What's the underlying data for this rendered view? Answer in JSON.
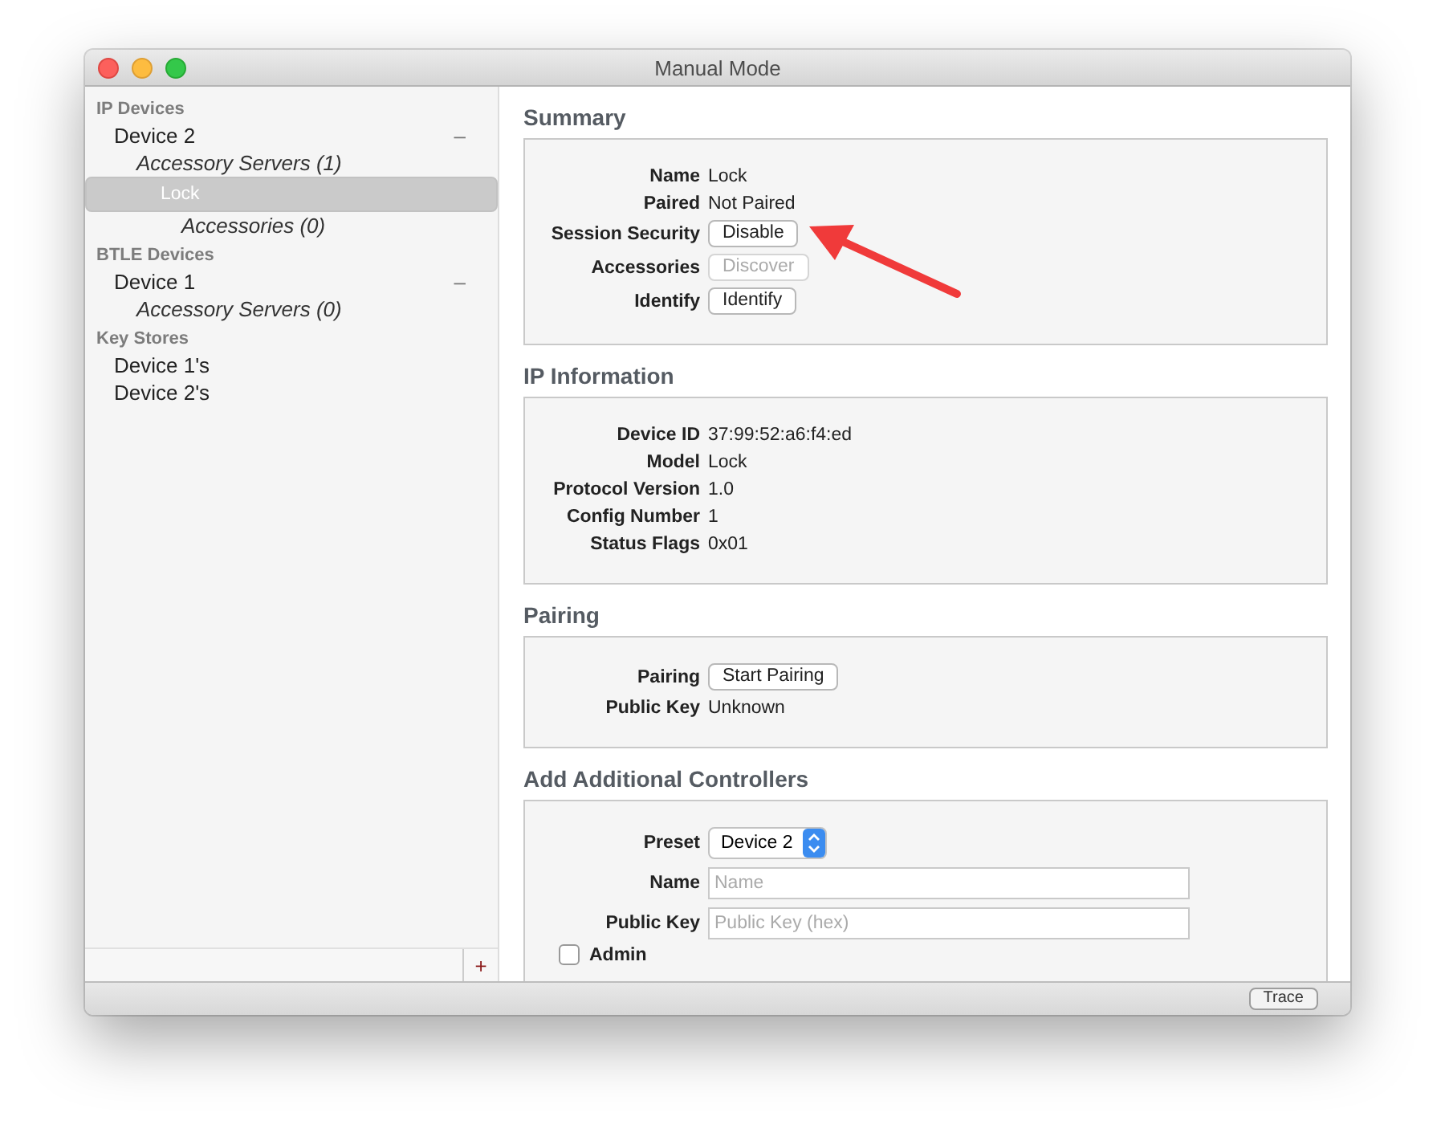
{
  "window": {
    "title": "Manual Mode"
  },
  "sidebar": {
    "groups": [
      {
        "heading": "IP Devices",
        "items": [
          {
            "label": "Device 2",
            "toggle": "–",
            "italic": false,
            "selected": false,
            "children": [
              {
                "label": "Accessory Servers (1)",
                "italic": true,
                "selected": false,
                "children": [
                  {
                    "label": "Lock",
                    "italic": false,
                    "selected": true,
                    "children": [
                      {
                        "label": "Accessories (0)",
                        "italic": true,
                        "selected": false
                      }
                    ]
                  }
                ]
              }
            ]
          }
        ]
      },
      {
        "heading": "BTLE Devices",
        "items": [
          {
            "label": "Device 1",
            "toggle": "–",
            "italic": false,
            "selected": false,
            "children": [
              {
                "label": "Accessory Servers (0)",
                "italic": true,
                "selected": false
              }
            ]
          }
        ]
      },
      {
        "heading": "Key Stores",
        "items": [
          {
            "label": "Device 1's",
            "italic": false,
            "selected": false
          },
          {
            "label": "Device 2's",
            "italic": false,
            "selected": false
          }
        ]
      }
    ],
    "add_button": "+"
  },
  "sections": [
    {
      "title": "Summary",
      "rows": [
        {
          "kind": "text",
          "label": "Name",
          "value": "Lock"
        },
        {
          "kind": "text",
          "label": "Paired",
          "value": "Not Paired"
        },
        {
          "kind": "button",
          "label": "Session Security",
          "value": "Disable",
          "disabled": false
        },
        {
          "kind": "button",
          "label": "Accessories",
          "value": "Discover",
          "disabled": true
        },
        {
          "kind": "button",
          "label": "Identify",
          "value": "Identify",
          "disabled": false
        }
      ]
    },
    {
      "title": "IP Information",
      "rows": [
        {
          "kind": "text",
          "label": "Device ID",
          "value": "37:99:52:a6:f4:ed"
        },
        {
          "kind": "text",
          "label": "Model",
          "value": "Lock"
        },
        {
          "kind": "text",
          "label": "Protocol Version",
          "value": "1.0"
        },
        {
          "kind": "text",
          "label": "Config Number",
          "value": "1"
        },
        {
          "kind": "text",
          "label": "Status Flags",
          "value": "0x01"
        }
      ]
    },
    {
      "title": "Pairing",
      "rows": [
        {
          "kind": "button",
          "label": "Pairing",
          "value": "Start Pairing",
          "disabled": false
        },
        {
          "kind": "text",
          "label": "Public Key",
          "value": "Unknown"
        }
      ]
    },
    {
      "title": "Add Additional Controllers",
      "rows": [
        {
          "kind": "select",
          "label": "Preset",
          "value": "Device 2"
        },
        {
          "kind": "input",
          "label": "Name",
          "placeholder": "Name"
        },
        {
          "kind": "input",
          "label": "Public Key",
          "placeholder": "Public Key (hex)"
        },
        {
          "kind": "checkbox",
          "label": "Admin",
          "checked": false
        }
      ]
    }
  ],
  "status_bar": {
    "button": "Trace"
  }
}
